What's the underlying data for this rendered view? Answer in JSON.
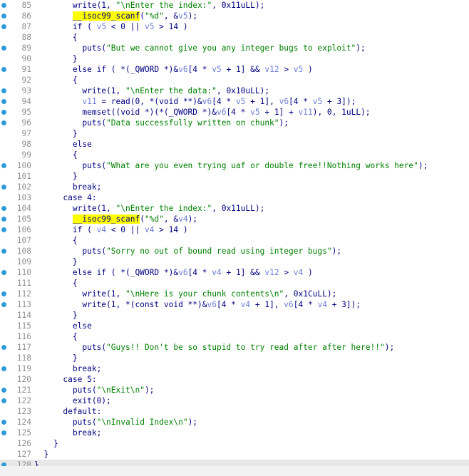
{
  "lines": [
    {
      "n": "85",
      "dot": true,
      "indent": "        ",
      "seg": [
        {
          "t": "write(1, "
        },
        {
          "t": "\"\\nEnter the index:\"",
          "c": "s"
        },
        {
          "t": ", 0x11uLL);"
        }
      ]
    },
    {
      "n": "86",
      "dot": true,
      "indent": "        ",
      "seg": [
        {
          "t": "__isoc99_scanf",
          "c": "hlf"
        },
        {
          "t": "("
        },
        {
          "t": "\"%d\"",
          "c": "s"
        },
        {
          "t": ", &"
        },
        {
          "t": "v5",
          "c": "v"
        },
        {
          "t": ");"
        }
      ]
    },
    {
      "n": "87",
      "dot": true,
      "indent": "        ",
      "seg": [
        {
          "t": "if ( "
        },
        {
          "t": "v5",
          "c": "v"
        },
        {
          "t": " < 0 || "
        },
        {
          "t": "v5",
          "c": "v"
        },
        {
          "t": " > 14 )"
        }
      ]
    },
    {
      "n": "88",
      "dot": false,
      "indent": "        ",
      "seg": [
        {
          "t": "{"
        }
      ]
    },
    {
      "n": "89",
      "dot": true,
      "indent": "          ",
      "seg": [
        {
          "t": "puts("
        },
        {
          "t": "\"But we cannot give you any integer bugs to exploit\"",
          "c": "s"
        },
        {
          "t": ");"
        }
      ]
    },
    {
      "n": "90",
      "dot": false,
      "indent": "        ",
      "seg": [
        {
          "t": "}"
        }
      ]
    },
    {
      "n": "91",
      "dot": true,
      "indent": "        ",
      "seg": [
        {
          "t": "else if ( *(_QWORD *)&"
        },
        {
          "t": "v6",
          "c": "v"
        },
        {
          "t": "[4 * "
        },
        {
          "t": "v5",
          "c": "v"
        },
        {
          "t": " + 1] && "
        },
        {
          "t": "v12",
          "c": "v"
        },
        {
          "t": " > "
        },
        {
          "t": "v5",
          "c": "v"
        },
        {
          "t": " )"
        }
      ]
    },
    {
      "n": "92",
      "dot": false,
      "indent": "        ",
      "seg": [
        {
          "t": "{"
        }
      ]
    },
    {
      "n": "93",
      "dot": true,
      "indent": "          ",
      "seg": [
        {
          "t": "write(1, "
        },
        {
          "t": "\"\\nEnter the data:\"",
          "c": "s"
        },
        {
          "t": ", 0x10uLL);"
        }
      ]
    },
    {
      "n": "94",
      "dot": true,
      "indent": "          ",
      "seg": [
        {
          "t": "v11",
          "c": "v"
        },
        {
          "t": " = read(0, *(void **)&"
        },
        {
          "t": "v6",
          "c": "v"
        },
        {
          "t": "[4 * "
        },
        {
          "t": "v5",
          "c": "v"
        },
        {
          "t": " + 1], "
        },
        {
          "t": "v6",
          "c": "v"
        },
        {
          "t": "[4 * "
        },
        {
          "t": "v5",
          "c": "v"
        },
        {
          "t": " + 3]);"
        }
      ]
    },
    {
      "n": "95",
      "dot": true,
      "indent": "          ",
      "seg": [
        {
          "t": "memset((void *)(*(_QWORD *)&"
        },
        {
          "t": "v6",
          "c": "v"
        },
        {
          "t": "[4 * "
        },
        {
          "t": "v5",
          "c": "v"
        },
        {
          "t": " + 1] + "
        },
        {
          "t": "v11",
          "c": "v"
        },
        {
          "t": "), 0, 1uLL);"
        }
      ]
    },
    {
      "n": "96",
      "dot": true,
      "indent": "          ",
      "seg": [
        {
          "t": "puts("
        },
        {
          "t": "\"Data successfully written on chunk\"",
          "c": "s"
        },
        {
          "t": ");"
        }
      ]
    },
    {
      "n": "97",
      "dot": false,
      "indent": "        ",
      "seg": [
        {
          "t": "}"
        }
      ]
    },
    {
      "n": "98",
      "dot": false,
      "indent": "        ",
      "seg": [
        {
          "t": "else"
        }
      ]
    },
    {
      "n": "99",
      "dot": false,
      "indent": "        ",
      "seg": [
        {
          "t": "{"
        }
      ]
    },
    {
      "n": "100",
      "dot": true,
      "indent": "          ",
      "seg": [
        {
          "t": "puts("
        },
        {
          "t": "\"What are you even trying uaf or double free!!Nothing works here\"",
          "c": "s"
        },
        {
          "t": ");"
        }
      ]
    },
    {
      "n": "101",
      "dot": false,
      "indent": "        ",
      "seg": [
        {
          "t": "}"
        }
      ]
    },
    {
      "n": "102",
      "dot": true,
      "indent": "        ",
      "seg": [
        {
          "t": "break;"
        }
      ]
    },
    {
      "n": "103",
      "dot": false,
      "indent": "      ",
      "seg": [
        {
          "t": "case 4:"
        }
      ]
    },
    {
      "n": "104",
      "dot": true,
      "indent": "        ",
      "seg": [
        {
          "t": "write(1, "
        },
        {
          "t": "\"\\nEnter the index:\"",
          "c": "s"
        },
        {
          "t": ", 0x11uLL);"
        }
      ]
    },
    {
      "n": "105",
      "dot": true,
      "indent": "        ",
      "seg": [
        {
          "t": "__isoc99_scanf",
          "c": "hlf"
        },
        {
          "t": "("
        },
        {
          "t": "\"%d\"",
          "c": "s"
        },
        {
          "t": ", &"
        },
        {
          "t": "v4",
          "c": "v"
        },
        {
          "t": ");"
        }
      ]
    },
    {
      "n": "106",
      "dot": true,
      "indent": "        ",
      "seg": [
        {
          "t": "if ( "
        },
        {
          "t": "v4",
          "c": "v"
        },
        {
          "t": " < 0 || "
        },
        {
          "t": "v4",
          "c": "v"
        },
        {
          "t": " > 14 )"
        }
      ]
    },
    {
      "n": "107",
      "dot": false,
      "indent": "        ",
      "seg": [
        {
          "t": "{"
        }
      ]
    },
    {
      "n": "108",
      "dot": true,
      "indent": "          ",
      "seg": [
        {
          "t": "puts("
        },
        {
          "t": "\"Sorry no out of bound read using integer bugs\"",
          "c": "s"
        },
        {
          "t": ");"
        }
      ]
    },
    {
      "n": "109",
      "dot": false,
      "indent": "        ",
      "seg": [
        {
          "t": "}"
        }
      ]
    },
    {
      "n": "110",
      "dot": true,
      "indent": "        ",
      "seg": [
        {
          "t": "else if ( *(_QWORD *)&"
        },
        {
          "t": "v6",
          "c": "v"
        },
        {
          "t": "[4 * "
        },
        {
          "t": "v4",
          "c": "v"
        },
        {
          "t": " + 1] && "
        },
        {
          "t": "v12",
          "c": "v"
        },
        {
          "t": " > "
        },
        {
          "t": "v4",
          "c": "v"
        },
        {
          "t": " )"
        }
      ]
    },
    {
      "n": "111",
      "dot": false,
      "indent": "        ",
      "seg": [
        {
          "t": "{"
        }
      ]
    },
    {
      "n": "112",
      "dot": true,
      "indent": "          ",
      "seg": [
        {
          "t": "write(1, "
        },
        {
          "t": "\"\\nHere is your chunk contents\\n\"",
          "c": "s"
        },
        {
          "t": ", 0x1CuLL);"
        }
      ]
    },
    {
      "n": "113",
      "dot": true,
      "indent": "          ",
      "seg": [
        {
          "t": "write(1, *(const void **)&"
        },
        {
          "t": "v6",
          "c": "v"
        },
        {
          "t": "[4 * "
        },
        {
          "t": "v4",
          "c": "v"
        },
        {
          "t": " + 1], "
        },
        {
          "t": "v6",
          "c": "v"
        },
        {
          "t": "[4 * "
        },
        {
          "t": "v4",
          "c": "v"
        },
        {
          "t": " + 3]);"
        }
      ]
    },
    {
      "n": "114",
      "dot": false,
      "indent": "        ",
      "seg": [
        {
          "t": "}"
        }
      ]
    },
    {
      "n": "115",
      "dot": false,
      "indent": "        ",
      "seg": [
        {
          "t": "else"
        }
      ]
    },
    {
      "n": "116",
      "dot": false,
      "indent": "        ",
      "seg": [
        {
          "t": "{"
        }
      ]
    },
    {
      "n": "117",
      "dot": true,
      "indent": "          ",
      "seg": [
        {
          "t": "puts("
        },
        {
          "t": "\"Guys!! Don't be so stupid to try read after after here!!\"",
          "c": "s"
        },
        {
          "t": ");"
        }
      ]
    },
    {
      "n": "118",
      "dot": false,
      "indent": "        ",
      "seg": [
        {
          "t": "}"
        }
      ]
    },
    {
      "n": "119",
      "dot": true,
      "indent": "        ",
      "seg": [
        {
          "t": "break;"
        }
      ]
    },
    {
      "n": "120",
      "dot": false,
      "indent": "      ",
      "seg": [
        {
          "t": "case 5:"
        }
      ]
    },
    {
      "n": "121",
      "dot": true,
      "indent": "        ",
      "seg": [
        {
          "t": "puts("
        },
        {
          "t": "\"\\nExit\\n\"",
          "c": "s"
        },
        {
          "t": ");"
        }
      ]
    },
    {
      "n": "122",
      "dot": true,
      "indent": "        ",
      "seg": [
        {
          "t": "exit(0);"
        }
      ]
    },
    {
      "n": "123",
      "dot": false,
      "indent": "      ",
      "seg": [
        {
          "t": "default:"
        }
      ]
    },
    {
      "n": "124",
      "dot": true,
      "indent": "        ",
      "seg": [
        {
          "t": "puts("
        },
        {
          "t": "\"\\nInvalid Index\\n\"",
          "c": "s"
        },
        {
          "t": ");"
        }
      ]
    },
    {
      "n": "125",
      "dot": true,
      "indent": "        ",
      "seg": [
        {
          "t": "break;"
        }
      ]
    },
    {
      "n": "126",
      "dot": false,
      "indent": "    ",
      "seg": [
        {
          "t": "}"
        }
      ]
    },
    {
      "n": "127",
      "dot": false,
      "indent": "  ",
      "seg": [
        {
          "t": "}"
        }
      ]
    },
    {
      "n": "128",
      "dot": true,
      "indent": "",
      "hl": true,
      "seg": [
        {
          "t": "}"
        }
      ]
    }
  ],
  "colors": {
    "background": "#ffffff",
    "code": "#000080",
    "string": "#008000",
    "variable": "#6e7ed6",
    "line_number": "#909090",
    "breakpoint_dot": "#2d9bd8",
    "highlight_name": "#ffff00",
    "current_line": "#e8e8e8"
  }
}
